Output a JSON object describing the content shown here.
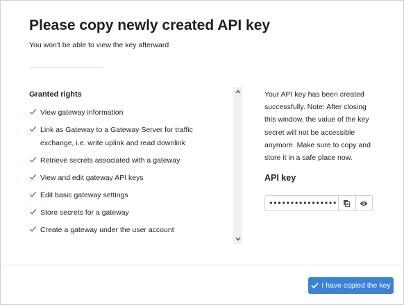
{
  "header": {
    "title": "Please copy newly created API key",
    "subtitle": "You won't be able to view the key afterward"
  },
  "rights": {
    "heading": "Granted rights",
    "items": [
      "View gateway information",
      "Link as Gateway to a Gateway Server for traffic exchange, i.e. write uplink and read downlink",
      "Retrieve secrets associated with a gateway",
      "View and edit gateway API keys",
      "Edit basic gateway settings",
      "Store secrets for a gateway",
      "Create a gateway under the user account"
    ]
  },
  "info": {
    "text": "Your API key has been created successfully. Note: After closing this window, the value of the key secret will not be accessible anymore. Make sure to copy and store it in a safe place now."
  },
  "api_key": {
    "label": "API key",
    "masked_value": "••••••••••••••••",
    "copy_icon": "copy-icon",
    "reveal_icon": "eye-icon"
  },
  "footer": {
    "confirm_label": "I have copied the key"
  },
  "colors": {
    "accent": "#3b82d6",
    "check": "#3b82d6"
  }
}
